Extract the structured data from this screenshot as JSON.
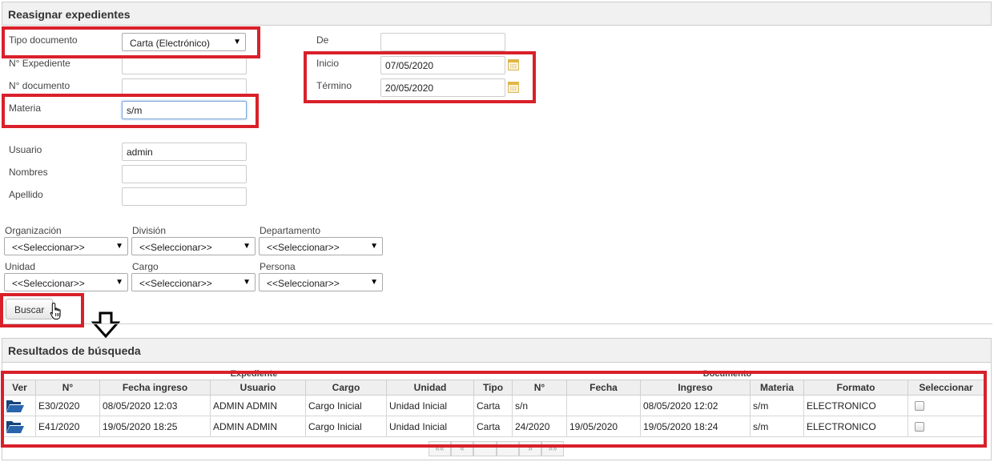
{
  "panel_reassign": {
    "title": "Reasignar expedientes"
  },
  "form": {
    "tipo_documento": {
      "label": "Tipo documento",
      "value": "Carta (Electrónico)"
    },
    "n_expediente": {
      "label": "N° Expediente",
      "value": ""
    },
    "n_documento": {
      "label": "N° documento",
      "value": ""
    },
    "materia": {
      "label": "Materia",
      "value": "s/m"
    },
    "de": {
      "label": "De",
      "value": ""
    },
    "inicio": {
      "label": "Inicio",
      "value": "07/05/2020"
    },
    "termino": {
      "label": "Término",
      "value": "20/05/2020"
    },
    "usuario": {
      "label": "Usuario",
      "value": "admin"
    },
    "nombres": {
      "label": "Nombres",
      "value": ""
    },
    "apellido": {
      "label": "Apellido",
      "value": ""
    }
  },
  "filters": {
    "organizacion": {
      "label": "Organización",
      "value": "<<Seleccionar>>"
    },
    "division": {
      "label": "División",
      "value": "<<Seleccionar>>"
    },
    "departamento": {
      "label": "Departamento",
      "value": "<<Seleccionar>>"
    },
    "unidad": {
      "label": "Unidad",
      "value": "<<Seleccionar>>"
    },
    "cargo": {
      "label": "Cargo",
      "value": "<<Seleccionar>>"
    },
    "persona": {
      "label": "Persona",
      "value": "<<Seleccionar>>"
    }
  },
  "buscar_label": "Buscar",
  "panel_results": {
    "title": "Resultados de búsqueda"
  },
  "results": {
    "group_expediente": "Expediente",
    "group_documento": "Documento",
    "columns": [
      "Ver",
      "N°",
      "Fecha ingreso",
      "Usuario",
      "Cargo",
      "Unidad",
      "Tipo",
      "N°",
      "Fecha",
      "Ingreso",
      "Materia",
      "Formato",
      "Seleccionar"
    ],
    "rows": [
      [
        "E30/2020",
        "08/05/2020 12:03",
        "ADMIN ADMIN",
        "Cargo Inicial",
        "Unidad Inicial",
        "Carta",
        "s/n",
        "",
        "08/05/2020 12:02",
        "s/m",
        "ELECTRONICO"
      ],
      [
        "E41/2020",
        "19/05/2020 18:25",
        "ADMIN ADMIN",
        "Cargo Inicial",
        "Unidad Inicial",
        "Carta",
        "24/2020",
        "19/05/2020",
        "19/05/2020 18:24",
        "s/m",
        "ELECTRONICO"
      ]
    ]
  },
  "pager": [
    "««",
    "«",
    "",
    "",
    "»",
    "»»"
  ],
  "icons": {
    "select_arrow": "▼",
    "row_open": "folder-open-icon",
    "calendar": "calendar-icon",
    "pointer": "hand-pointer-icon",
    "arrow_down": "arrow-down-icon"
  },
  "colors": {
    "highlight": "#d9202a",
    "folder": "#1f4f8f"
  }
}
